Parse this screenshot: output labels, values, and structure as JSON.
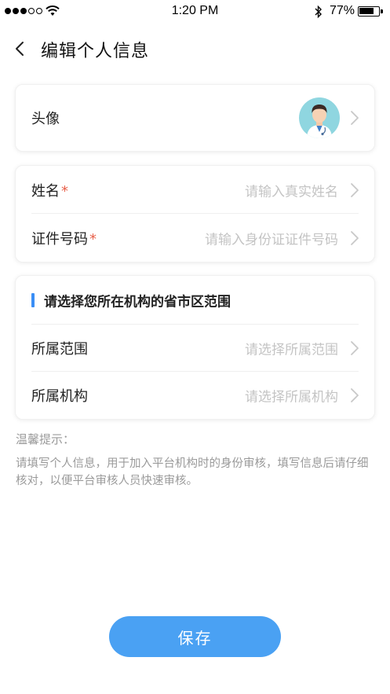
{
  "status_bar": {
    "time": "1:20 PM",
    "battery_text": "77%",
    "battery_level": 0.77,
    "signal_bars_filled": 3,
    "signal_bars_total": 5
  },
  "nav": {
    "back_icon": "chevron-left-icon",
    "title": "编辑个人信息"
  },
  "avatar_card": {
    "label": "头像",
    "avatar_icon": "doctor-avatar-icon"
  },
  "identity_card": {
    "name": {
      "label": "姓名",
      "required_mark": "*",
      "placeholder": "请输入真实姓名"
    },
    "id_number": {
      "label": "证件号码",
      "required_mark": "*",
      "placeholder": "请输入身份证证件号码"
    }
  },
  "org_card": {
    "section_title": "请选择您所在机构的省市区范围",
    "scope": {
      "label": "所属范围",
      "placeholder": "请选择所属范围"
    },
    "institution": {
      "label": "所属机构",
      "placeholder": "请选择所属机构"
    }
  },
  "tips": {
    "title": "温馨提示：",
    "body": "请填写个人信息，用于加入平台机构时的身份审核，填写信息后请仔细核对，以便平台审核人员快速审核。"
  },
  "save_button": {
    "label": "保存"
  },
  "colors": {
    "accent": "#4aa1f3",
    "section_bar": "#3a8ef6",
    "required": "#e8614b",
    "placeholder": "#c4c4c4"
  }
}
